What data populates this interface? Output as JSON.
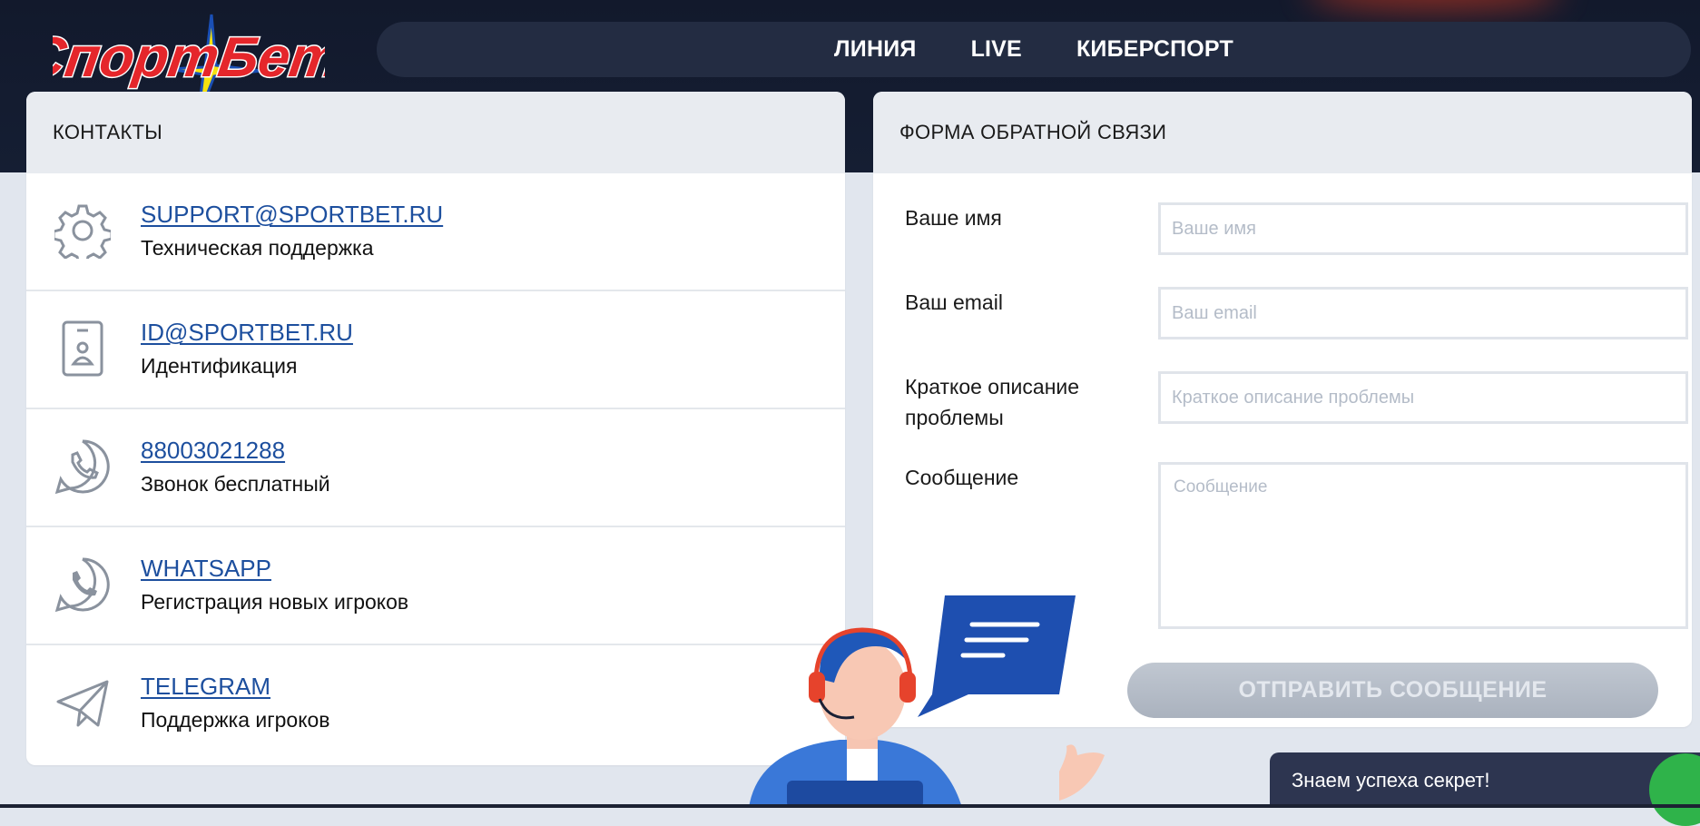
{
  "brand": {
    "logo_text": "СпортБет"
  },
  "nav": {
    "items": [
      {
        "label": "ЛИНИЯ"
      },
      {
        "label": "LIVE"
      },
      {
        "label": "КИБЕРСПОРТ"
      }
    ]
  },
  "contacts": {
    "title": "КОНТАКТЫ",
    "items": [
      {
        "icon": "gear-icon",
        "link": "SUPPORT@SPORTBET.RU",
        "desc": "Техническая поддержка"
      },
      {
        "icon": "id-card-icon",
        "link": "ID@SPORTBET.RU",
        "desc": "Идентификация"
      },
      {
        "icon": "phone-icon",
        "link": "88003021288",
        "desc": "Звонок бесплатный"
      },
      {
        "icon": "whatsapp-icon",
        "link": "WHATSAPP",
        "desc": "Регистрация новых игроков"
      },
      {
        "icon": "telegram-icon",
        "link": "TELEGRAM",
        "desc": "Поддержка игроков"
      }
    ]
  },
  "form": {
    "title": "ФОРМА ОБРАТНОЙ СВЯЗИ",
    "name_label": "Ваше имя",
    "name_placeholder": "Ваше имя",
    "name_value": "",
    "email_label": "Ваш email",
    "email_placeholder": "Ваш email",
    "email_value": "",
    "subject_label": "Краткое описание проблемы",
    "subject_placeholder": "Краткое описание проблемы",
    "subject_value": "",
    "message_label": "Сообщение",
    "message_placeholder": "Сообщение",
    "message_value": "",
    "submit_label": "ОТПРАВИТЬ СООБЩЕНИЕ"
  },
  "chat": {
    "text": "Знаем успеха секрет!"
  },
  "colors": {
    "header_bg": "#12192c",
    "nav_bg": "#232c42",
    "link": "#1d4f9e",
    "submit_bg": "#b6bdc8",
    "chat_bg": "#2d3550",
    "chat_dot": "#2fb34a"
  }
}
